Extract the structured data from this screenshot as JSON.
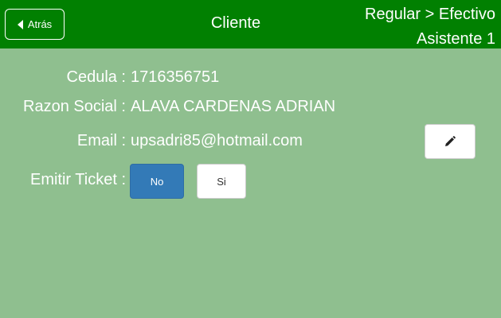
{
  "header": {
    "back_label": "Atrás",
    "title": "Cliente",
    "mode": "Regular > Efectivo",
    "assistant": "Asistente 1"
  },
  "client": {
    "cedula_label": "Cedula :",
    "cedula_value": "1716356751",
    "razon_label": "Razon Social :",
    "razon_value": "ALAVA CARDENAS ADRIAN",
    "email_label": "Email :",
    "email_value": "upsadri85@hotmail.com"
  },
  "ticket": {
    "label": "Emitir Ticket :",
    "no_label": "No",
    "si_label": "Si",
    "selected": "No"
  },
  "colors": {
    "header_bg": "#018001",
    "body_bg": "#8fbf8f",
    "selected_btn": "#337ab7"
  },
  "icons": {
    "back": "caret-left-icon",
    "edit": "pencil-icon"
  }
}
